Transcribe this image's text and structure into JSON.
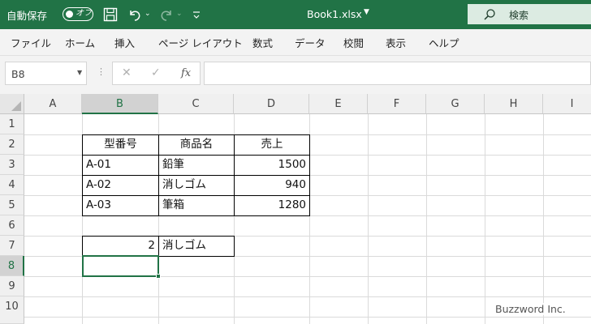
{
  "titlebar": {
    "autosave_label": "自動保存",
    "autosave_toggle": "オフ",
    "filename": "Book1.xlsx",
    "search_placeholder": "検索"
  },
  "menu": [
    "ファイル",
    "ホーム",
    "挿入",
    "ページ レイアウト",
    "数式",
    "データ",
    "校閲",
    "表示",
    "ヘルプ"
  ],
  "formula_bar": {
    "name_box": "B8",
    "fx": "fx",
    "formula": ""
  },
  "grid": {
    "columns": [
      "A",
      "B",
      "C",
      "D",
      "E",
      "F",
      "G",
      "H",
      "I"
    ],
    "rows": [
      "1",
      "2",
      "3",
      "4",
      "5",
      "6",
      "7",
      "8",
      "9",
      "10"
    ],
    "selected_cell": "B8",
    "cells": {
      "B2": "型番号",
      "C2": "商品名",
      "D2": "売上",
      "B3": "A-01",
      "C3": "鉛筆",
      "D3": "1500",
      "B4": "A-02",
      "C4": "消しゴム",
      "D4": "940",
      "B5": "A-03",
      "C5": "筆箱",
      "D5": "1280",
      "B7": "2",
      "C7": "消しゴム"
    }
  },
  "watermark": "Buzzword Inc.",
  "colors": {
    "accent": "#217346",
    "searchbox": "#dcebe2"
  }
}
